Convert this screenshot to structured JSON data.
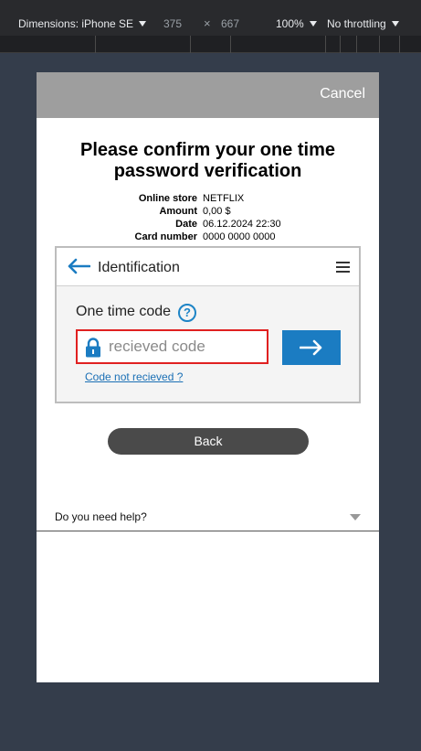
{
  "devtools": {
    "dimensions_label": "Dimensions: iPhone SE",
    "width": "375",
    "times": "×",
    "height": "667",
    "zoom": "100%",
    "throttling": "No throttling"
  },
  "header": {
    "cancel_label": "Cancel"
  },
  "title": "Please confirm your one time password verification",
  "info": {
    "rows": [
      {
        "label": "Online store",
        "value": "NETFLIX"
      },
      {
        "label": "Amount",
        "value": "0,00 $"
      },
      {
        "label": "Date",
        "value": "06.12.2024 22:30"
      },
      {
        "label": "Card number",
        "value": "0000 0000 0000"
      }
    ]
  },
  "panel": {
    "title": "Identification",
    "otc_label": "One time code",
    "help_symbol": "?",
    "input_placeholder": "recieved code",
    "not_received_link": "Code not recieved ?"
  },
  "back_label": "Back",
  "help": {
    "label": "Do you need help?"
  },
  "colors": {
    "accent": "#1b7cc2",
    "error_border": "#e02020",
    "topbar": "#9e9e9e",
    "button_dark": "#4a4a4a"
  },
  "icons": [
    "back-arrow-icon",
    "menu-icon",
    "help-icon",
    "lock-icon",
    "arrow-right-icon",
    "chevron-down-icon"
  ]
}
